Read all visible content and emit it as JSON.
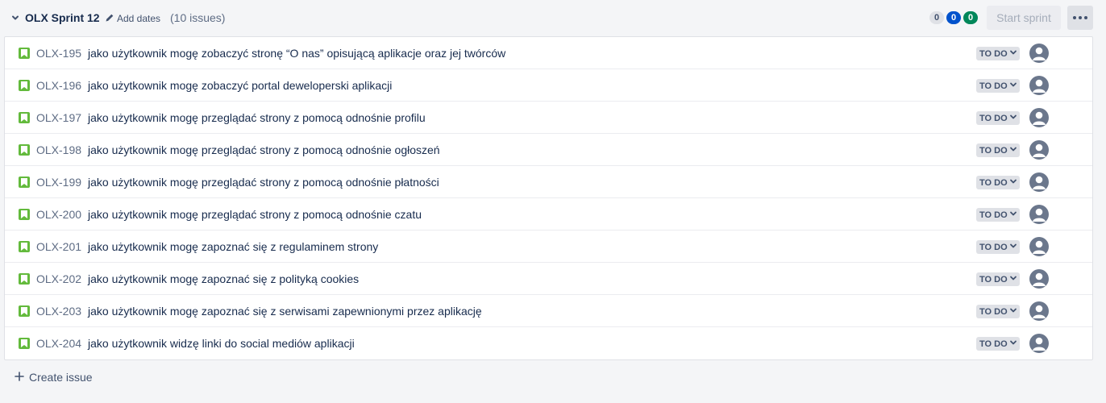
{
  "sprint": {
    "name": "OLX Sprint 12",
    "add_dates_label": "Add dates",
    "issue_count": "(10 issues)",
    "badges": {
      "todo": "0",
      "in_progress": "0",
      "done": "0"
    },
    "start_sprint_label": "Start sprint"
  },
  "colors": {
    "story": "#63ba3c",
    "badge_in_progress": "#0052cc",
    "badge_done": "#00875a"
  },
  "issues": [
    {
      "key": "OLX-195",
      "summary": "jako użytkownik mogę zobaczyć stronę “O nas” opisującą aplikacje oraz jej twórców",
      "status": "TO DO"
    },
    {
      "key": "OLX-196",
      "summary": "jako użytkownik mogę zobaczyć portal deweloperski aplikacji",
      "status": "TO DO"
    },
    {
      "key": "OLX-197",
      "summary": "jako użytkownik mogę przeglądać strony z pomocą odnośnie profilu",
      "status": "TO DO"
    },
    {
      "key": "OLX-198",
      "summary": "jako użytkownik mogę przeglądać strony z pomocą odnośnie ogłoszeń",
      "status": "TO DO"
    },
    {
      "key": "OLX-199",
      "summary": "jako użytkownik mogę przeglądać strony z pomocą odnośnie płatności",
      "status": "TO DO"
    },
    {
      "key": "OLX-200",
      "summary": "jako użytkownik mogę przeglądać strony z pomocą odnośnie czatu",
      "status": "TO DO"
    },
    {
      "key": "OLX-201",
      "summary": "jako użytkownik mogę zapoznać się z regulaminem strony",
      "status": "TO DO"
    },
    {
      "key": "OLX-202",
      "summary": "jako użytkownik mogę zapoznać się z polityką cookies",
      "status": "TO DO"
    },
    {
      "key": "OLX-203",
      "summary": "jako użytkownik mogę zapoznać się z serwisami zapewnionymi przez aplikację",
      "status": "TO DO"
    },
    {
      "key": "OLX-204",
      "summary": "jako użytkownik widzę linki do social mediów aplikacji",
      "status": "TO DO"
    }
  ],
  "footer": {
    "create_issue_label": "Create issue"
  }
}
